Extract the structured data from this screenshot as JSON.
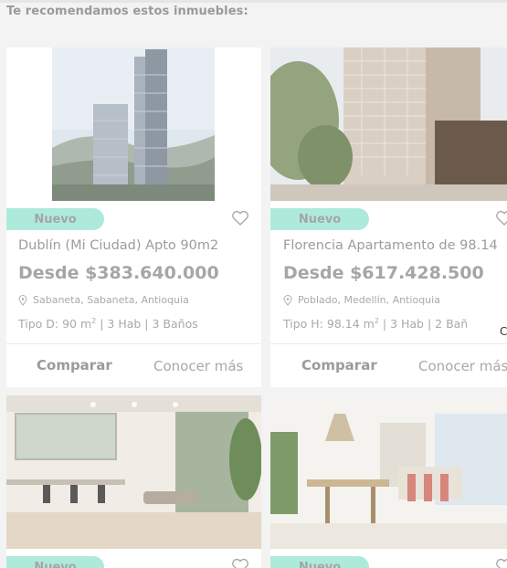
{
  "section_title": "Te recomendamos estos inmuebles:",
  "colors": {
    "badge": "#aeeadc",
    "card": "#ffffff",
    "background": "#f3f3f3"
  },
  "cards": [
    {
      "badge": "Nuevo",
      "title": "Dublín (Mi Ciudad) Apto 90m2",
      "price": "Desde $383.640.000",
      "location": "Sabaneta, Sabaneta, Antioquia",
      "spec_prefix": "Tipo D: 90 m",
      "spec_suffix": " | 3 Hab | 3 Baños",
      "spec_sup": "2",
      "compare": "Comparar",
      "more": "Conocer más"
    },
    {
      "badge": "Nuevo",
      "title": "Florencia Apartamento de 98.14",
      "price": "Desde $617.428.500",
      "location": "Poblado, Medellín, Antioquia",
      "spec_prefix": "Tipo H: 98.14 m",
      "spec_suffix": " | 3 Hab | 2 Bañ",
      "spec_sup": "2",
      "compare": "Comparar",
      "more": "Conocer más"
    },
    {
      "badge": "Nuevo"
    },
    {
      "badge": "Nuevo"
    }
  ],
  "edge_text": "C"
}
